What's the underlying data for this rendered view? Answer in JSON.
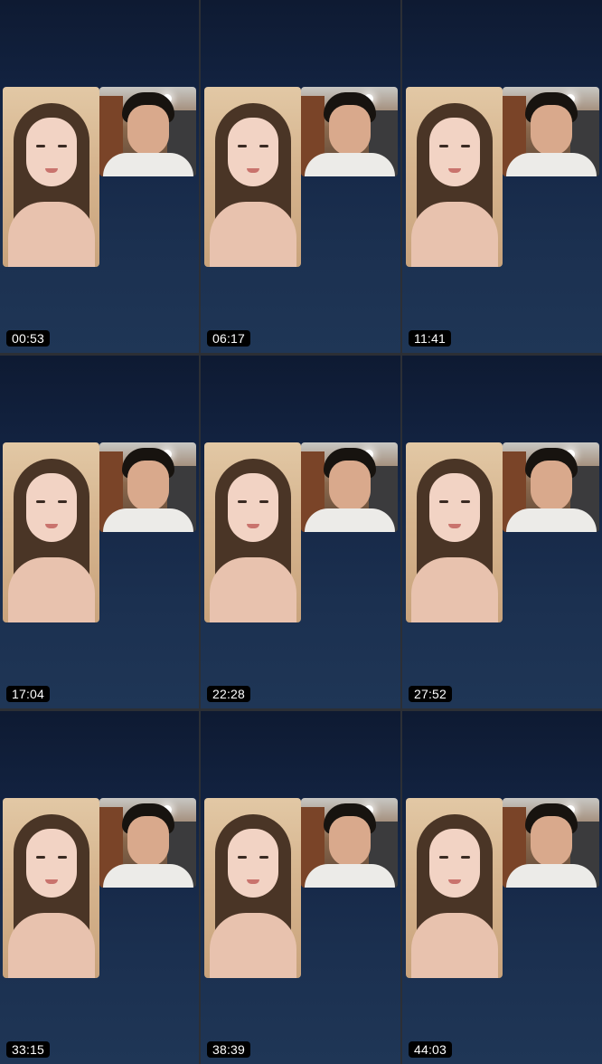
{
  "frames": [
    {
      "timestamp": "00:53"
    },
    {
      "timestamp": "06:17"
    },
    {
      "timestamp": "11:41"
    },
    {
      "timestamp": "17:04"
    },
    {
      "timestamp": "22:28"
    },
    {
      "timestamp": "27:52"
    },
    {
      "timestamp": "33:15"
    },
    {
      "timestamp": "38:39"
    },
    {
      "timestamp": "44:03"
    }
  ],
  "colors": {
    "background_top": "#0e1a32",
    "background_bottom": "#1f3656",
    "timestamp_bg": "#000000",
    "timestamp_text": "#ffffff"
  }
}
